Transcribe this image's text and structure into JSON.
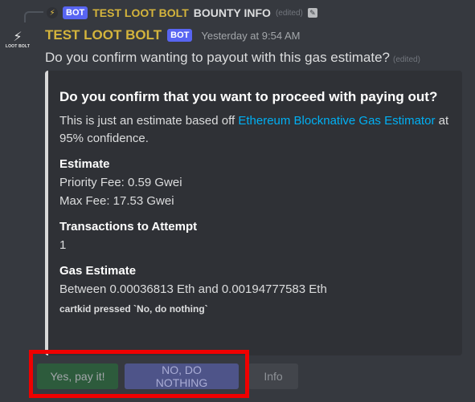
{
  "reply": {
    "bot_tag": "BOT",
    "author": "TEST LOOT BOLT",
    "text": "BOUNTY INFO",
    "edited": "(edited)"
  },
  "message": {
    "author": "TEST LOOT BOLT",
    "bot_tag": "BOT",
    "timestamp": "Yesterday at 9:54 AM",
    "text": "Do you confirm wanting to payout with this gas estimate?",
    "edited": "(edited)"
  },
  "avatar": {
    "logo_text": "LOOT BOLT"
  },
  "embed": {
    "title": "Do you confirm that you want to proceed with paying out?",
    "description_pre": "This is just an estimate based off ",
    "description_link": "Ethereum Blocknative Gas Estimator",
    "description_post": " at 95% confidence.",
    "fields": [
      {
        "name": "Estimate",
        "lines": [
          "Priority Fee: 0.59 Gwei",
          "Max Fee: 17.53 Gwei"
        ]
      },
      {
        "name": "Transactions to Attempt",
        "lines": [
          "1"
        ]
      },
      {
        "name": "Gas Estimate",
        "lines": [
          "Between 0.00036813 Eth and 0.00194777583 Eth"
        ]
      }
    ],
    "footer_note": "cartkid pressed `No, do nothing`"
  },
  "buttons": {
    "yes": "Yes, pay it!",
    "no": "NO, DO NOTHING",
    "info": "Info"
  },
  "colors": {
    "background": "#36393f",
    "embed_bg": "#2f3136",
    "username": "#d4b43c",
    "link": "#00b0f4",
    "highlight": "#f00000"
  }
}
